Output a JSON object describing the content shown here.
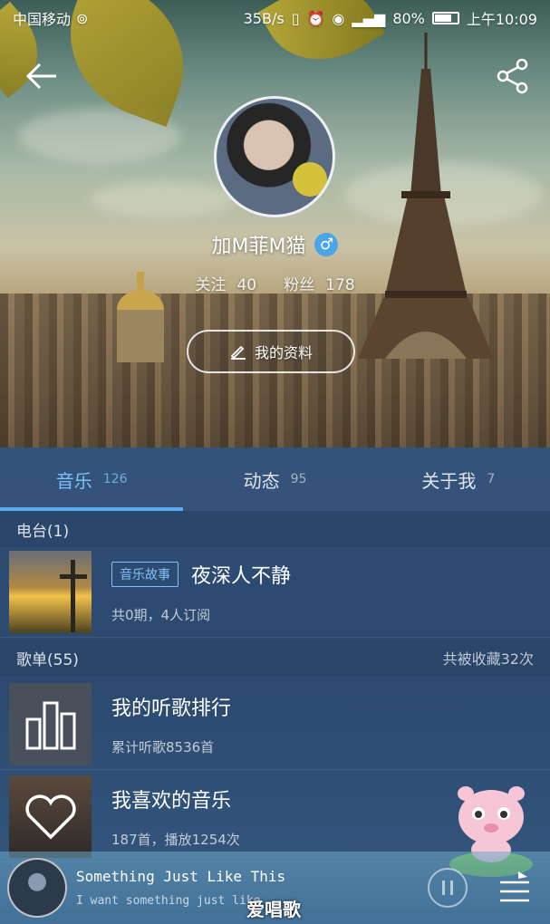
{
  "status_bar": {
    "carrier": "中国移动",
    "speed": "35B/s",
    "battery": "80%",
    "time": "上午10:09"
  },
  "profile": {
    "username": "加M菲M猫",
    "gender_symbol": "♂",
    "follow_label": "关注",
    "follow_count": "40",
    "fans_label": "粉丝",
    "fans_count": "178",
    "profile_button": "我的资料"
  },
  "tabs": [
    {
      "label": "音乐",
      "count": "126"
    },
    {
      "label": "动态",
      "count": "95"
    },
    {
      "label": "关于我",
      "count": "7"
    }
  ],
  "radio": {
    "header": "电台(1)",
    "item": {
      "tag": "音乐故事",
      "title": "夜深人不静",
      "subtitle": "共0期，4人订阅"
    }
  },
  "playlists": {
    "header": "歌单(55)",
    "collected": "共被收藏32次",
    "items": [
      {
        "title": "我的听歌排行",
        "subtitle": "累计听歌8536首"
      },
      {
        "title": "我喜欢的音乐",
        "subtitle": "187首，播放1254次"
      }
    ]
  },
  "player": {
    "song": "Something Just Like This",
    "lyric": "I want something just like",
    "watermark": "爱唱歌"
  },
  "colors": {
    "accent": "#7ec0f5",
    "panel": "#2f4d74"
  }
}
